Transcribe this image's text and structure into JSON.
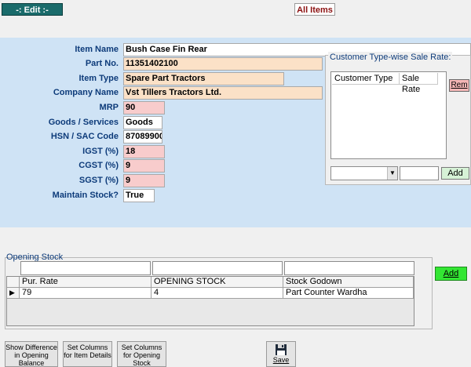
{
  "header": {
    "edit_label": "-: Edit :-",
    "all_items_label": "All Items"
  },
  "form": {
    "fields": [
      {
        "label": "Item Name",
        "value": "Bush Case Fin Rear"
      },
      {
        "label": "Part No.",
        "value": "11351402100"
      },
      {
        "label": "Item Type",
        "value": "Spare Part Tractors"
      },
      {
        "label": "Company Name",
        "value": "Vst Tillers Tractors Ltd."
      },
      {
        "label": "MRP",
        "value": "90"
      },
      {
        "label": "Goods / Services",
        "value": "Goods"
      },
      {
        "label": "HSN / SAC Code",
        "value": "87089900"
      },
      {
        "label": "IGST (%)",
        "value": "18"
      },
      {
        "label": "CGST (%)",
        "value": "9"
      },
      {
        "label": "SGST (%)",
        "value": "9"
      },
      {
        "label": "Maintain Stock?",
        "value": "True"
      }
    ]
  },
  "customer_rates": {
    "title": "Customer Type-wise Sale Rate:",
    "columns": [
      "Customer Type",
      "Sale Rate"
    ],
    "remove_label": "Rem",
    "add_label": "Add",
    "combo_arrow_icon": "chevron-down-icon"
  },
  "opening_stock": {
    "title": "Opening Stock",
    "add_label": "Add",
    "columns": [
      "Pur. Rate",
      "OPENING STOCK",
      "Stock Godown"
    ],
    "rows": [
      {
        "pur_rate": "79",
        "opening_stock": "4",
        "stock_godown": "Part Counter Wardha"
      }
    ],
    "row_indicator_icon": "row-pointer-icon"
  },
  "footer": {
    "buttons": [
      "Show Difference in Opening Balance",
      "Set Columns for Item Details",
      "Set Columns for Opening Stock"
    ],
    "save_label": "Save",
    "save_icon": "floppy-disk-icon"
  },
  "colors": {
    "edit_badge": "#1a6b6b",
    "form_panel": "#cfe3f5",
    "peach_field": "#fbe1c7",
    "pink_field": "#f8cccc",
    "add_green": "#33e633"
  }
}
